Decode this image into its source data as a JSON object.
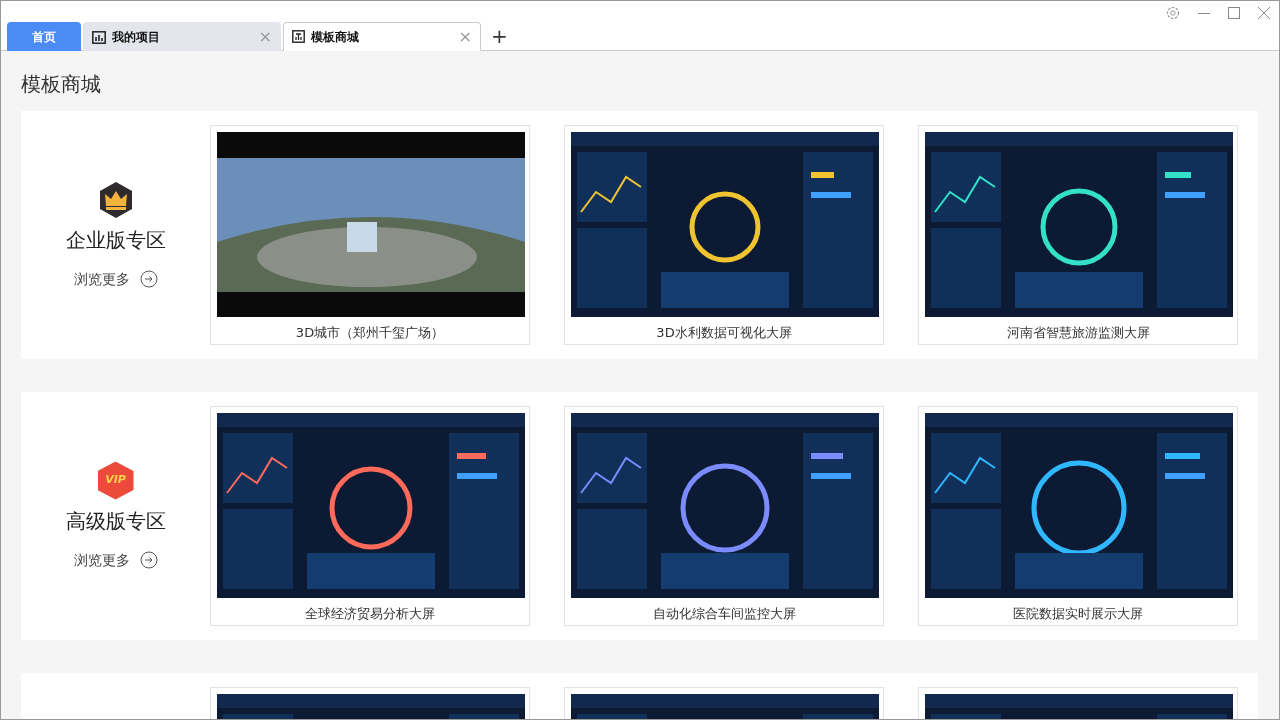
{
  "tabs": [
    {
      "label": "首页",
      "kind": "home",
      "selected": false
    },
    {
      "label": "我的项目",
      "kind": "chart",
      "close": "×",
      "selected": false
    },
    {
      "label": "模板商城",
      "kind": "template",
      "close": "×",
      "selected": true
    }
  ],
  "new_tab": "+",
  "page_title": "模板商城",
  "sections": [
    {
      "kind": "crown",
      "title": "企业版专区",
      "more": "浏览更多",
      "items": [
        {
          "kind": "picture",
          "caption": "3D城市（郑州千玺广场）"
        },
        {
          "kind": "picture",
          "caption": "3D水利数据可视化大屏"
        },
        {
          "kind": "picture",
          "caption": "河南省智慧旅游监测大屏"
        }
      ]
    },
    {
      "kind": "vip",
      "badge_text": "VIP",
      "title": "高级版专区",
      "more": "浏览更多",
      "items": [
        {
          "kind": "picture",
          "caption": "全球经济贸易分析大屏"
        },
        {
          "kind": "picture",
          "caption": "自动化综合车间监控大屏"
        },
        {
          "kind": "picture",
          "caption": "医院数据实时展示大屏"
        }
      ]
    },
    {
      "items": [
        {
          "kind": "picture"
        },
        {
          "kind": "picture"
        },
        {
          "kind": "picture"
        }
      ]
    }
  ]
}
